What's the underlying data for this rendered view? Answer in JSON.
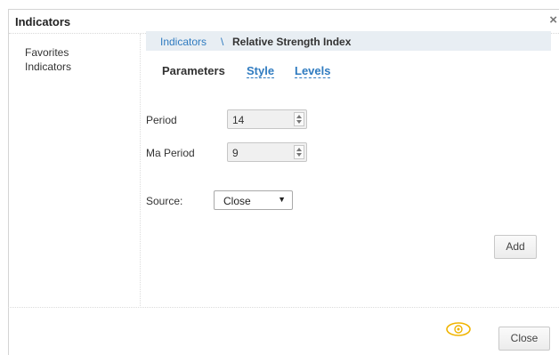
{
  "dialog": {
    "title": "Indicators",
    "close_symbol": "×"
  },
  "sidebar": {
    "items": [
      {
        "label": "Favorites"
      },
      {
        "label": "Indicators"
      }
    ]
  },
  "breadcrumb": {
    "link": "Indicators",
    "separator": "\\",
    "current": "Relative Strength Index"
  },
  "tabs": [
    {
      "label": "Parameters",
      "active": true
    },
    {
      "label": "Style",
      "active": false
    },
    {
      "label": "Levels",
      "active": false
    }
  ],
  "params": {
    "period": {
      "label": "Period",
      "value": "14"
    },
    "ma_period": {
      "label": "Ma Period",
      "value": "9"
    },
    "source": {
      "label": "Source:",
      "value": "Close"
    }
  },
  "buttons": {
    "add": "Add",
    "close": "Close"
  },
  "icons": {
    "close": "close-icon",
    "eye": "eye-icon",
    "spin_up": "arrow-up-icon",
    "spin_down": "arrow-down-icon",
    "caret": "caret-down-icon"
  },
  "colors": {
    "link": "#2f7bc0",
    "breadcrumb_bg": "#e8eef3",
    "eye": "#f0b400"
  }
}
